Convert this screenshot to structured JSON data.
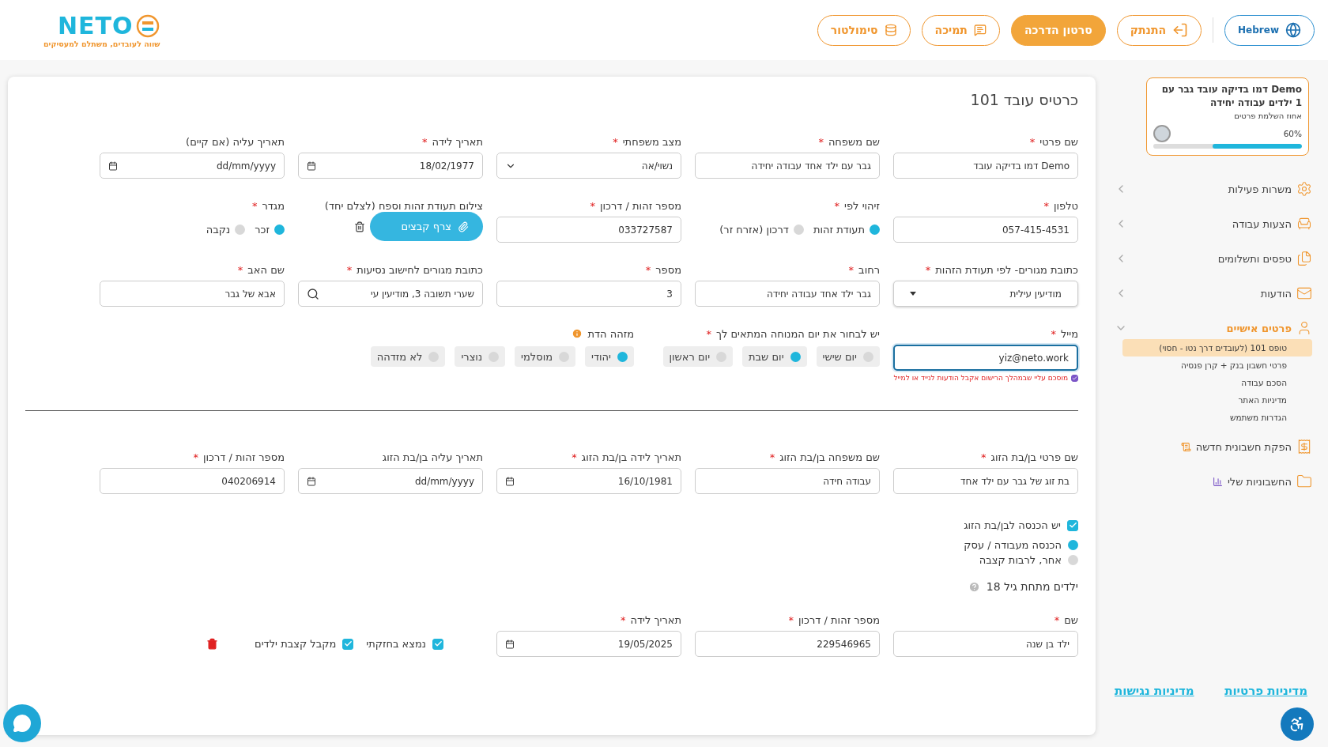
{
  "header": {
    "logo": {
      "name": "NETO",
      "tagline": "שווה לעובדים, משתלם למעסיקים"
    },
    "buttons": [
      {
        "label": "Hebrew",
        "kind": "language"
      },
      {
        "label": "התנתק",
        "kind": "logout"
      },
      {
        "label": "סרטון הדרכה",
        "kind": "primary"
      },
      {
        "label": "תמיכה",
        "kind": "support"
      },
      {
        "label": "סימולטור",
        "kind": "simulator"
      }
    ]
  },
  "sidebar": {
    "profile": {
      "name": "Demo דמו בדיקה עובד גבר עם 1 ילדים עבודה יחידה",
      "progress_label": "אחוז השלמת פרטים",
      "percent": "60%",
      "level": 0.6
    },
    "menu": [
      {
        "label": "משרות פעילות",
        "expanded": false
      },
      {
        "label": "הצעות עבודה",
        "expanded": false
      },
      {
        "label": "טפסים ותשלומים",
        "expanded": false
      },
      {
        "label": "הודעות",
        "expanded": false
      },
      {
        "label": "פרטים אישיים",
        "expanded": true,
        "children": [
          {
            "label": "טופס 101 (לעובדים דרך נטו - חסוי)",
            "selected": true
          },
          {
            "label": "פרטי חשבון בנק + קרן פנסיה",
            "selected": false
          },
          {
            "label": "הסכם עבודה",
            "selected": false
          },
          {
            "label": "מדיניות האתר",
            "selected": false
          },
          {
            "label": "הגדרות משתמש",
            "selected": false
          }
        ]
      },
      {
        "label": "הפקת חשבונית חדשה"
      },
      {
        "label": "החשבוניות שלי"
      }
    ],
    "footer_links": [
      "מדיניות פרטיות",
      "מדיניות נגישות"
    ]
  },
  "form": {
    "title": "כרטיס עובד 101",
    "rows": [
      [
        {
          "kind": "text",
          "label": "שם פרטי",
          "required_mark": "*",
          "value": "Demo דמו בדיקה עובד"
        },
        {
          "kind": "text",
          "label": "שם משפחה",
          "required_mark": "*",
          "value": "גבר עם ילד אחד עבודה יחידה"
        },
        {
          "kind": "select",
          "label": "מצב משפחתי",
          "required_mark": "*",
          "value": "נשוי/אה"
        },
        {
          "kind": "date",
          "label": "תאריך לידה",
          "required_mark": "*",
          "value": "18/02/1977"
        },
        {
          "kind": "date",
          "label": "תאריך עליה (אם קיים)",
          "placeholder": "dd/mm/yyyy"
        }
      ],
      [
        {
          "kind": "text",
          "label": "טלפון",
          "required_mark": "*",
          "value": "057-415-4531"
        },
        {
          "kind": "radio",
          "label": "זיהוי לפי",
          "required_mark": "*",
          "options": [
            {
              "label": "תעודת זהות",
              "selected": true
            },
            {
              "label": "דרכון (אזרח זר)",
              "selected": false
            }
          ]
        },
        {
          "kind": "text",
          "label": "מספר זהות / דרכון",
          "required_mark": "*",
          "value": "033727587"
        },
        {
          "kind": "upload",
          "label": "צילום תעודת זהות וספח (לצלם יחד)",
          "button": "צרף קבצים"
        },
        {
          "kind": "radio",
          "label": "מגדר",
          "required_mark": "*",
          "options": [
            {
              "label": "זכר",
              "selected": true
            },
            {
              "label": "נקבה",
              "selected": false
            }
          ]
        }
      ],
      [
        {
          "kind": "dropdown",
          "label": "כתובת מגורים- לפי תעודת הזהות",
          "required_mark": "*",
          "value": "מודיעין עילית"
        },
        {
          "kind": "text",
          "label": "רחוב",
          "required_mark": "*",
          "value": "גבר ילד אחד עבודה יחידה"
        },
        {
          "kind": "text",
          "label": "מספר",
          "required_mark": "*",
          "value": "3"
        },
        {
          "kind": "search",
          "label": "כתובת מגורים לחישוב נסיעות",
          "required_mark": "*",
          "value": "שערי תשובה 3, מודיעין עי"
        },
        {
          "kind": "text",
          "label": "שם האב",
          "required_mark": "*",
          "value": "אבא של גבר"
        }
      ],
      [
        {
          "kind": "email",
          "label": "מייל",
          "required_mark": "*",
          "value": "yiz@neto.work",
          "focused": true,
          "consent": {
            "label": "מוסכם עליי שבמהלך הרישום אקבל הודעות לנייד או למייל",
            "checked": true
          }
        },
        {
          "kind": "chips",
          "label": "יש לבחור את יום המנוחה המתאים לך",
          "required_mark": "*",
          "options": [
            {
              "label": "יום שישי",
              "selected": false
            },
            {
              "label": "יום שבת",
              "selected": true
            },
            {
              "label": "יום ראשון",
              "selected": false
            }
          ]
        },
        {
          "kind": "chips",
          "label": "מזהה הדת",
          "info": true,
          "options": [
            {
              "label": "יהודי",
              "selected": true
            },
            {
              "label": "מוסלמי",
              "selected": false
            },
            {
              "label": "נוצרי",
              "selected": false
            },
            {
              "label": "לא מזדהה",
              "selected": false
            }
          ]
        }
      ]
    ],
    "spouse_rows": [
      [
        {
          "kind": "text",
          "label": "שם פרטי בן/בת הזוג",
          "required_mark": "*",
          "value": "בת זוג של גבר עם ילד אחד"
        },
        {
          "kind": "text",
          "label": "שם משפחה בן/בת הזוג",
          "required_mark": "*",
          "value": "עבודה חידה"
        },
        {
          "kind": "date",
          "label": "תאריך לידה בן/בת הזוג",
          "required_mark": "*",
          "value": "16/10/1981"
        },
        {
          "kind": "date",
          "label": "תאריך עליה בן/בת הזוג",
          "placeholder": "dd/mm/yyyy"
        },
        {
          "kind": "text",
          "label": "מספר זהות / דרכון",
          "required_mark": "*",
          "value": "040206914"
        }
      ]
    ],
    "spouse_income": {
      "label": "יש הכנסה לבן/בת הזוג",
      "checked": true,
      "options": [
        {
          "label": "הכנסה מעבודה / עסק",
          "selected": true
        },
        {
          "label": "אחר, לרבות קצבה",
          "selected": false
        }
      ]
    },
    "children_title": "ילדים מתחת גיל 18",
    "child_rows": [
      [
        {
          "kind": "text",
          "label": "שם",
          "required_mark": "*",
          "value": "ילד בן שנה"
        },
        {
          "kind": "text",
          "label": "מספר זהות / דרכון",
          "required_mark": "*",
          "value": "229546965"
        },
        {
          "kind": "date",
          "label": "תאריך לידה",
          "required_mark": "*",
          "value": "19/05/2025"
        },
        {
          "kind": "checks",
          "options": [
            {
              "label": "נמצא בחזקתי",
              "checked": true
            },
            {
              "label": "מקבל קצבת ילדים",
              "checked": true
            }
          ],
          "removable": true
        }
      ]
    ]
  }
}
